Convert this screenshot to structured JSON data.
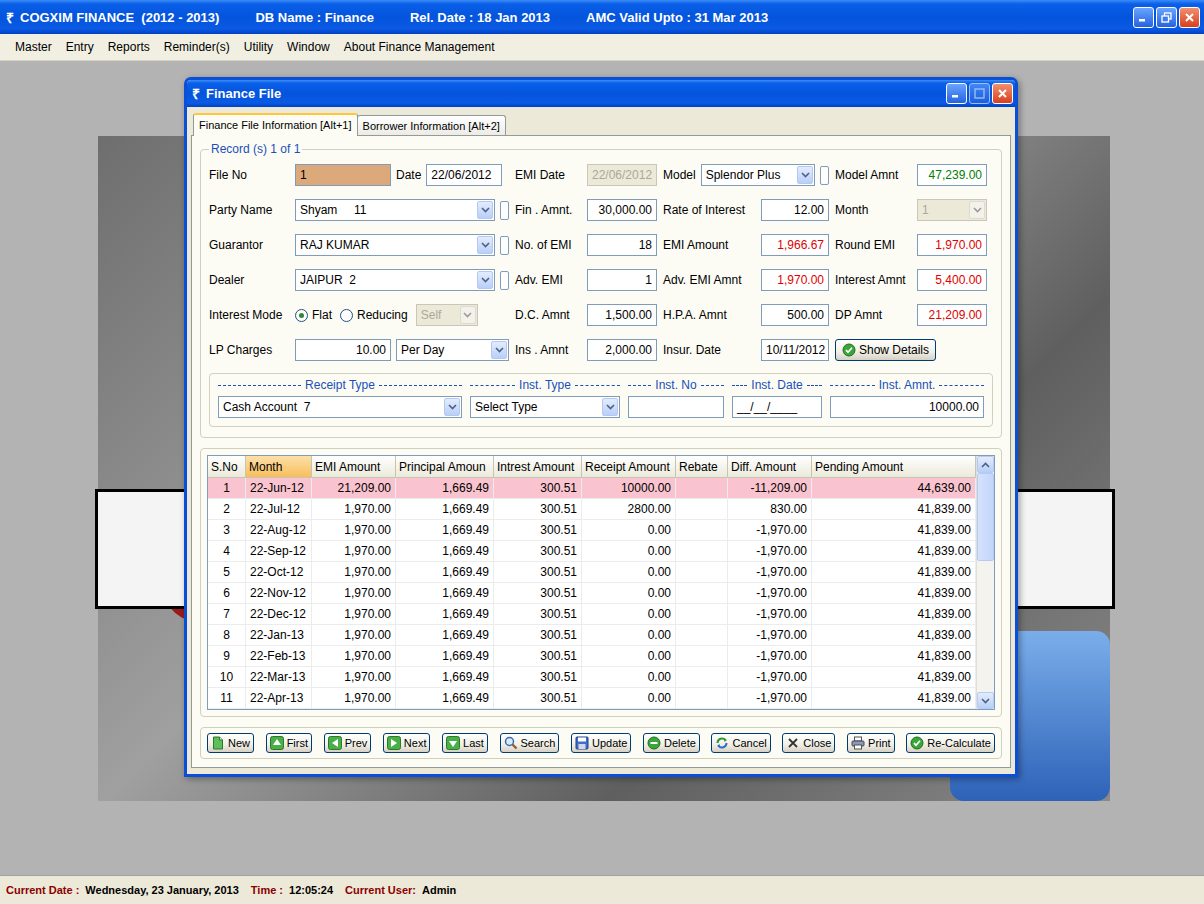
{
  "app": {
    "icon": "₹",
    "title": "COGXIM FINANCE  (2012 - 2013)",
    "info": [
      "DB Name : Finance",
      "Rel. Date : 18 Jan 2013",
      "AMC Valid Upto : 31 Mar 2013"
    ]
  },
  "menu": [
    "Master",
    "Entry",
    "Reports",
    "Reminder(s)",
    "Utility",
    "Window",
    "About Finance Management"
  ],
  "window": {
    "icon": "₹",
    "title": "Finance File"
  },
  "tabs": [
    {
      "label": "Finance File Information [Alt+1]",
      "selected": true
    },
    {
      "label": "Borrower Information [Alt+2]",
      "selected": false
    }
  ],
  "record": "Record (s) 1 of 1",
  "form": {
    "file_no": {
      "label": "File No",
      "value": "1"
    },
    "date": {
      "label": "Date",
      "value": "22/06/2012"
    },
    "emi_date": {
      "label": "EMI Date",
      "value": "22/06/2012",
      "disabled": true
    },
    "model": {
      "label": "Model",
      "value": "Splendor Plus"
    },
    "model_amnt": {
      "label": "Model Amnt",
      "value": "47,239.00"
    },
    "party": {
      "label": "Party Name",
      "value": "Shyam     11"
    },
    "fin_amnt": {
      "label": "Fin . Amnt.",
      "value": "30,000.00"
    },
    "rate": {
      "label": "Rate of Interest",
      "value": "12.00"
    },
    "month": {
      "label": "Month",
      "value": "1",
      "disabled": true
    },
    "guarantor": {
      "label": "Guarantor",
      "value": "RAJ KUMAR"
    },
    "no_emi": {
      "label": "No. of EMI",
      "value": "18"
    },
    "emi_amount": {
      "label": "EMI Amount",
      "value": "1,966.67"
    },
    "round_emi": {
      "label": "Round EMI",
      "value": "1,970.00"
    },
    "dealer": {
      "label": "Dealer",
      "value": "JAIPUR  2"
    },
    "adv_emi": {
      "label": "Adv. EMI",
      "value": "1"
    },
    "adv_emi_amnt": {
      "label": "Adv. EMI Amnt",
      "value": "1,970.00"
    },
    "interest_amnt": {
      "label": "Interest Amnt",
      "value": "5,400.00"
    },
    "interest_mode": {
      "label": "Interest Mode",
      "options": [
        {
          "label": "Flat",
          "selected": true
        },
        {
          "label": "Reducing",
          "selected": false
        }
      ],
      "type": {
        "value": "Self",
        "disabled": true
      }
    },
    "dc_amnt": {
      "label": "D.C. Amnt",
      "value": "1,500.00"
    },
    "hpa_amnt": {
      "label": "H.P.A. Amnt",
      "value": "500.00"
    },
    "dp_amnt": {
      "label": "DP Amnt",
      "value": "21,209.00"
    },
    "lp_charges": {
      "label": "LP Charges",
      "value": "10.00",
      "unit": "Per Day"
    },
    "ins_amnt": {
      "label": "Ins . Amnt",
      "value": "2,000.00"
    },
    "insur_date": {
      "label": "Insur. Date",
      "value": "10/11/2012"
    },
    "show_details": "Show Details"
  },
  "receipt": {
    "headers": [
      "Receipt Type",
      "Inst. Type",
      "Inst. No",
      "Inst. Date",
      "Inst. Amnt."
    ],
    "receipt_type": "Cash Account  7",
    "inst_type": "Select Type",
    "inst_no": "",
    "inst_date": "__/__/____",
    "inst_amnt": "10000.00"
  },
  "table": {
    "columns": [
      {
        "label": "S.No",
        "selected": false
      },
      {
        "label": "Month",
        "selected": true
      },
      {
        "label": "EMI Amount",
        "selected": false
      },
      {
        "label": "Principal Amoun",
        "selected": false
      },
      {
        "label": "Intrest Amount",
        "selected": false
      },
      {
        "label": "Receipt Amount",
        "selected": false
      },
      {
        "label": "Rebate",
        "selected": false
      },
      {
        "label": "Diff. Amount",
        "selected": false
      },
      {
        "label": "Pending Amount",
        "selected": false
      }
    ],
    "rows": [
      {
        "cells": [
          "1",
          "22-Jun-12",
          "21,209.00",
          "1,669.49",
          "300.51",
          "10000.00",
          "",
          "-11,209.00",
          "44,639.00"
        ],
        "selected": true
      },
      {
        "cells": [
          "2",
          "22-Jul-12",
          "1,970.00",
          "1,669.49",
          "300.51",
          "2800.00",
          "",
          "830.00",
          "41,839.00"
        ],
        "selected": false
      },
      {
        "cells": [
          "3",
          "22-Aug-12",
          "1,970.00",
          "1,669.49",
          "300.51",
          "0.00",
          "",
          "-1,970.00",
          "41,839.00"
        ],
        "selected": false
      },
      {
        "cells": [
          "4",
          "22-Sep-12",
          "1,970.00",
          "1,669.49",
          "300.51",
          "0.00",
          "",
          "-1,970.00",
          "41,839.00"
        ],
        "selected": false
      },
      {
        "cells": [
          "5",
          "22-Oct-12",
          "1,970.00",
          "1,669.49",
          "300.51",
          "0.00",
          "",
          "-1,970.00",
          "41,839.00"
        ],
        "selected": false
      },
      {
        "cells": [
          "6",
          "22-Nov-12",
          "1,970.00",
          "1,669.49",
          "300.51",
          "0.00",
          "",
          "-1,970.00",
          "41,839.00"
        ],
        "selected": false
      },
      {
        "cells": [
          "7",
          "22-Dec-12",
          "1,970.00",
          "1,669.49",
          "300.51",
          "0.00",
          "",
          "-1,970.00",
          "41,839.00"
        ],
        "selected": false
      },
      {
        "cells": [
          "8",
          "22-Jan-13",
          "1,970.00",
          "1,669.49",
          "300.51",
          "0.00",
          "",
          "-1,970.00",
          "41,839.00"
        ],
        "selected": false
      },
      {
        "cells": [
          "9",
          "22-Feb-13",
          "1,970.00",
          "1,669.49",
          "300.51",
          "0.00",
          "",
          "-1,970.00",
          "41,839.00"
        ],
        "selected": false
      },
      {
        "cells": [
          "10",
          "22-Mar-13",
          "1,970.00",
          "1,669.49",
          "300.51",
          "0.00",
          "",
          "-1,970.00",
          "41,839.00"
        ],
        "selected": false
      },
      {
        "cells": [
          "11",
          "22-Apr-13",
          "1,970.00",
          "1,669.49",
          "300.51",
          "0.00",
          "",
          "-1,970.00",
          "41,839.00"
        ],
        "selected": false
      }
    ],
    "scroll": {
      "level": 0
    }
  },
  "buttons": [
    "New",
    "First",
    "Prev",
    "Next",
    "Last",
    "Search",
    "Update",
    "Delete",
    "Cancel",
    "Close",
    "Print",
    "Re-Calculate"
  ],
  "status_bar": [
    {
      "label": "Current Date :",
      "value": "Wednesday, 23 January, 2013"
    },
    {
      "label": "Time :",
      "value": "12:05:24"
    },
    {
      "label": "Current User:",
      "value": "Admin"
    }
  ]
}
